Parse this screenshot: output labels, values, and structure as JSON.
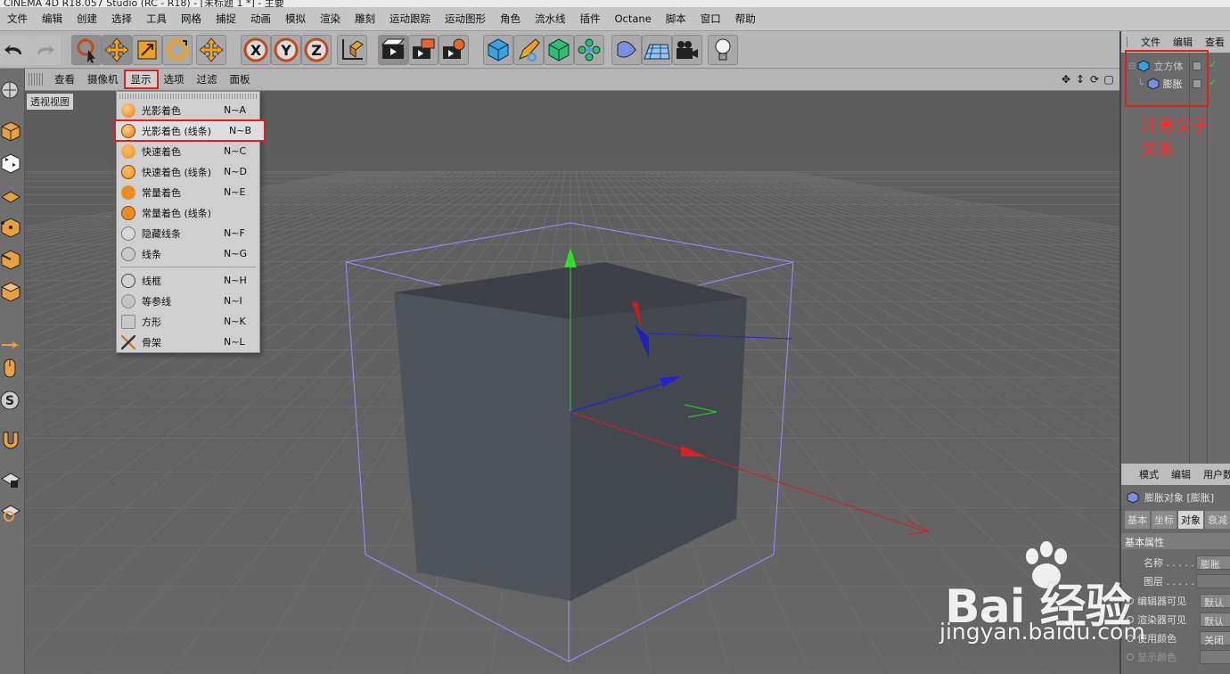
{
  "window": {
    "title": "CINEMA 4D R18.057 Studio (RC - R18) - [未标题 1 *] - 主要"
  },
  "menubar": [
    "文件",
    "编辑",
    "创建",
    "选择",
    "工具",
    "网格",
    "捕捉",
    "动画",
    "模拟",
    "渲染",
    "雕刻",
    "运动跟踪",
    "运动图形",
    "角色",
    "流水线",
    "插件",
    "Octane",
    "脚本",
    "窗口",
    "帮助"
  ],
  "toolbar": {
    "icons": [
      "undo-icon",
      "redo-icon",
      "live-select-icon",
      "move-icon",
      "scale-icon",
      "rotate-icon",
      "move-alt-icon",
      "x-axis-icon",
      "y-axis-icon",
      "z-axis-icon",
      "coordinate-system-icon",
      "render-view-icon",
      "render-to-picture-viewer-icon",
      "render-settings-icon",
      "cube-icon",
      "pen-icon",
      "subdivision-icon",
      "cloner-icon",
      "deformer-icon",
      "floor-icon",
      "camera-icon",
      "light-icon"
    ],
    "axis_labels": [
      "X",
      "Y",
      "Z"
    ]
  },
  "viewport": {
    "menu": [
      "查看",
      "摄像机",
      "显示",
      "选项",
      "过滤",
      "面板"
    ],
    "selected_menu": "显示",
    "label": "透视视图"
  },
  "display_menu": {
    "items": [
      {
        "label": "光影着色",
        "shortcut": "N~A",
        "icon": "shaded-icon",
        "highlighted": false
      },
      {
        "label": "光影着色 (线条)",
        "shortcut": "N~B",
        "icon": "shaded-lines-icon",
        "highlighted": true
      },
      {
        "label": "快速着色",
        "shortcut": "N~C",
        "icon": "quick-shading-icon",
        "highlighted": false
      },
      {
        "label": "快速着色 (线条)",
        "shortcut": "N~D",
        "icon": "quick-shading-lines-icon",
        "highlighted": false
      },
      {
        "label": "常量着色",
        "shortcut": "N~E",
        "icon": "constant-shading-icon",
        "highlighted": false
      },
      {
        "label": "常量着色 (线条)",
        "shortcut": "",
        "icon": "constant-shading-lines-icon",
        "highlighted": false
      },
      {
        "label": "隐藏线条",
        "shortcut": "N~F",
        "icon": "hidden-line-icon",
        "highlighted": false
      },
      {
        "label": "线条",
        "shortcut": "N~G",
        "icon": "lines-icon",
        "highlighted": false
      },
      {
        "label": "线框",
        "shortcut": "N~H",
        "icon": "wireframe-icon",
        "highlighted": false
      },
      {
        "label": "等参线",
        "shortcut": "N~I",
        "icon": "isoparms-icon",
        "highlighted": false
      },
      {
        "label": "方形",
        "shortcut": "N~K",
        "icon": "box-icon",
        "highlighted": false
      },
      {
        "label": "骨架",
        "shortcut": "N~L",
        "icon": "skeleton-icon",
        "highlighted": false
      }
    ]
  },
  "object_manager": {
    "menu": [
      "文件",
      "编辑",
      "查看"
    ],
    "objects": [
      {
        "name": "立方体",
        "icon": "cube-icon",
        "level": 0
      },
      {
        "name": "膨胀",
        "icon": "bulge-deformer-icon",
        "level": 1
      }
    ]
  },
  "annotation": {
    "line1": "注意父子",
    "line2": "关系"
  },
  "attribute_manager": {
    "menu": [
      "模式",
      "编辑",
      "用户数"
    ],
    "object_title": "膨胀对象 [膨胀]",
    "tabs": [
      "基本",
      "坐标",
      "对象",
      "衰减"
    ],
    "active_tab": "对象",
    "section": "基本属性",
    "properties": [
      {
        "label": "名称 . . . . .",
        "value": "膨胀",
        "radio": false
      },
      {
        "label": "图层 . . . . .",
        "value": "",
        "radio": false
      },
      {
        "label": "编辑器可见",
        "value": "默认",
        "radio": true
      },
      {
        "label": "渲染器可见",
        "value": "默认",
        "radio": true
      },
      {
        "label": "使用颜色",
        "value": "关闭",
        "radio": true
      },
      {
        "label": "显示颜色",
        "value": "",
        "radio": true
      }
    ]
  },
  "watermark": {
    "brand": "Bai  经验",
    "url": "jingyan.baidu.com"
  },
  "colors": {
    "menubar": "#c6c6c6",
    "toolbar": "#b7b7b7",
    "viewport_bg": "#5b5b5b",
    "cube": "#4e545b",
    "bbox": "#9a8cff",
    "highlight": "#e02020",
    "axis_x": "#e02020",
    "axis_y": "#20c020",
    "axis_z": "#2020e0"
  }
}
